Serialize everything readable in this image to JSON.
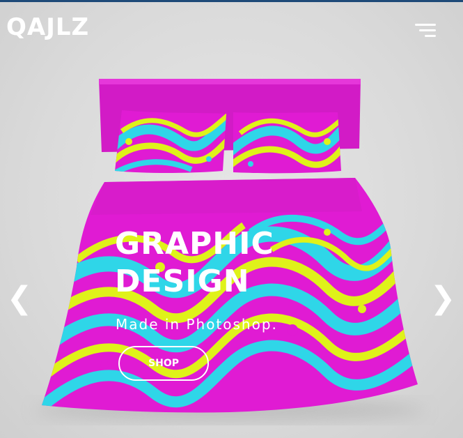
{
  "header": {
    "logo_text": "QAJLZ",
    "menu_icon": "hamburger-menu-icon"
  },
  "slider": {
    "title_line1": "GRAPHIC",
    "title_line2": "DESIGN",
    "subtitle": "Made in Photoshop.",
    "cta_label": "SHOP",
    "prev_label": "❮",
    "next_label": "❯"
  },
  "colors": {
    "magenta": "#e01bd3",
    "cyan": "#2fd6e8",
    "lime": "#dff21a",
    "text": "#ffffff",
    "top_stripe": "#1e4a78"
  }
}
